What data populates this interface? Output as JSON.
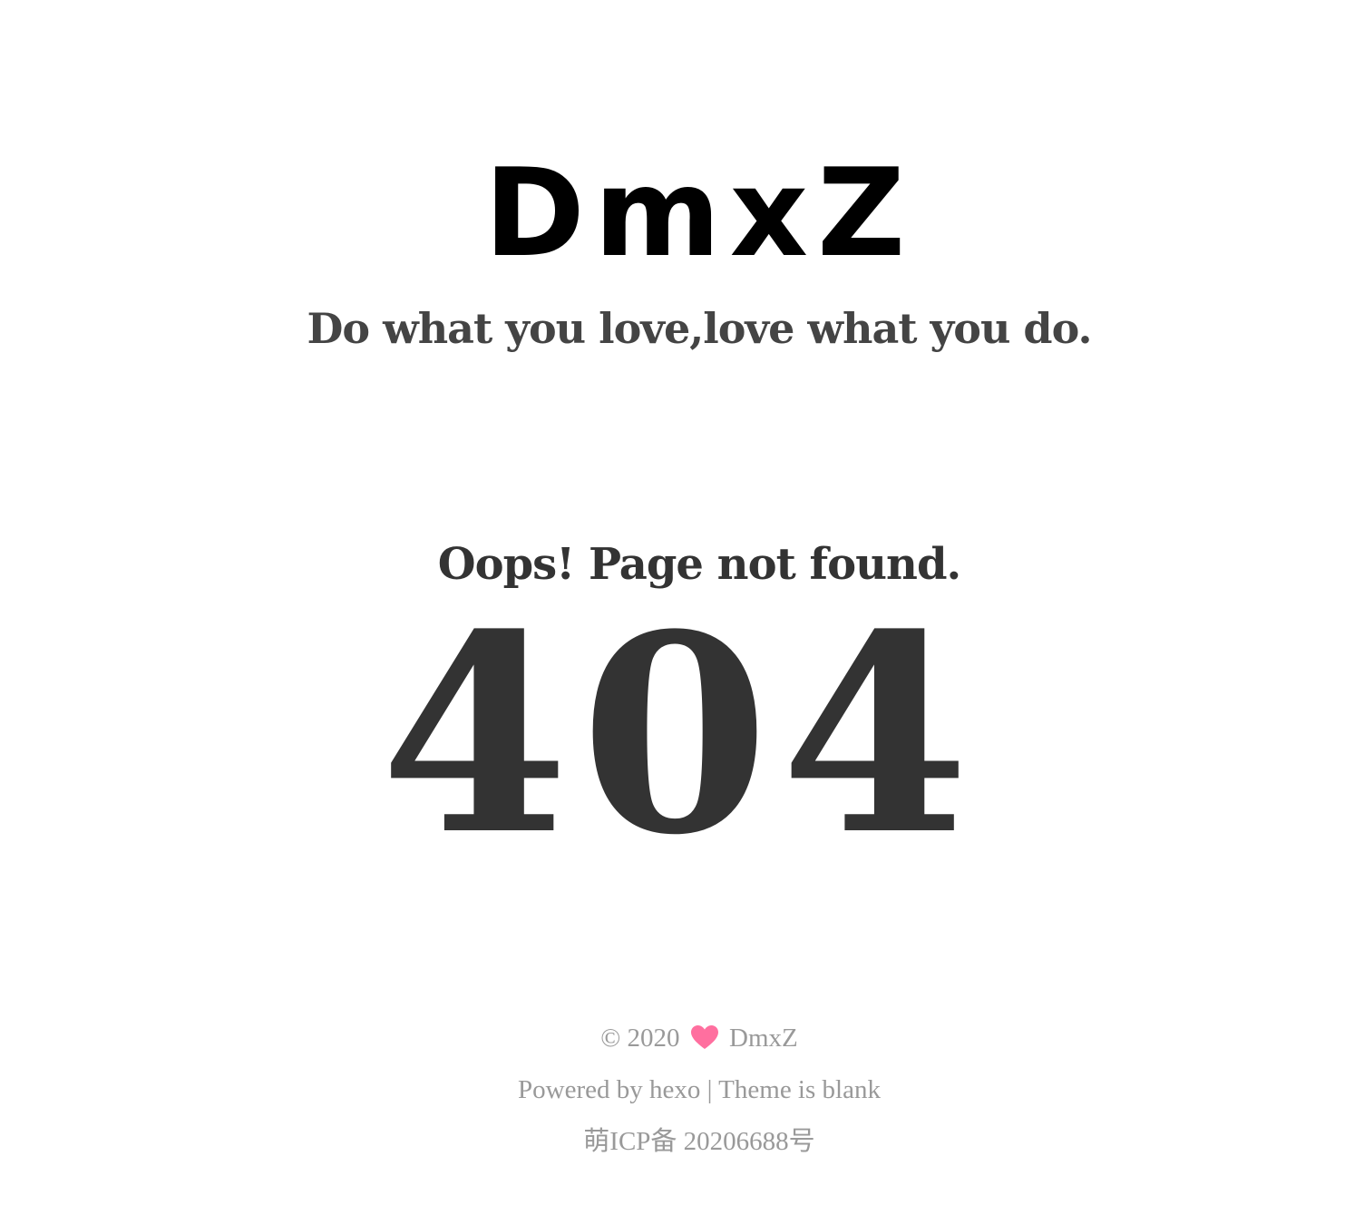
{
  "header": {
    "title": "DmxZ",
    "subtitle": "Do what you love,love what you do."
  },
  "error": {
    "message": "Oops! Page not found.",
    "code": "404"
  },
  "footer": {
    "copyright_symbol": "©",
    "year": "2020",
    "heart_icon": "heart-icon",
    "heart_color": "#ff6f9f",
    "author": "DmxZ",
    "powered_by": "Powered by hexo",
    "separator": "|",
    "theme": "Theme is blank",
    "icp": "萌ICP备 20206688号"
  }
}
